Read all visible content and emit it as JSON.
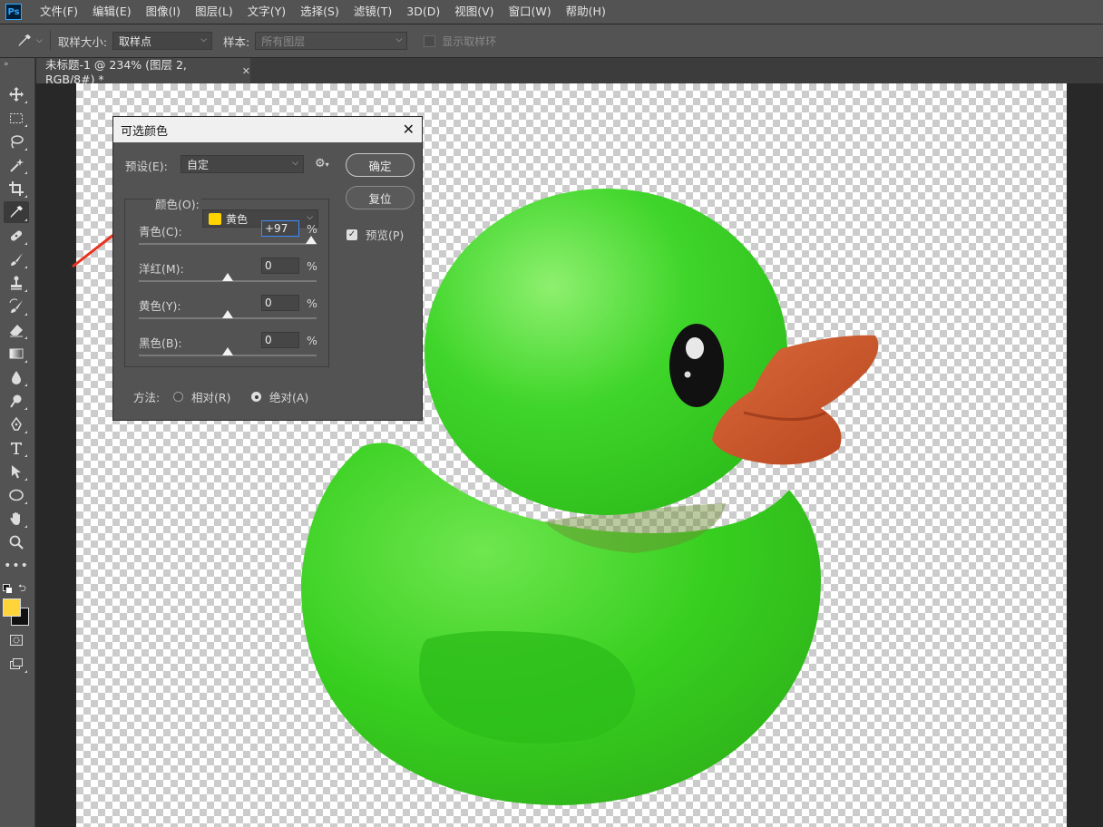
{
  "menubar": {
    "logo": "Ps",
    "items": [
      "文件(F)",
      "编辑(E)",
      "图像(I)",
      "图层(L)",
      "文字(Y)",
      "选择(S)",
      "滤镜(T)",
      "3D(D)",
      "视图(V)",
      "窗口(W)",
      "帮助(H)"
    ]
  },
  "options": {
    "sample_size_label": "取样大小:",
    "sample_size_value": "取样点",
    "sample_label": "样本:",
    "sample_value": "所有图层",
    "show_ring_label": "显示取样环"
  },
  "document": {
    "tab_title": "未标题-1 @ 234% (图层 2, RGB/8#) *"
  },
  "dialog": {
    "title": "可选颜色",
    "preset_label": "预设(E):",
    "preset_value": "自定",
    "ok_label": "确定",
    "reset_label": "复位",
    "preview_label": "预览(P)",
    "colors_label": "颜色(O):",
    "colors_value": "黄色",
    "colors_swatch": "#ffd400",
    "sliders": [
      {
        "label": "青色(C):",
        "value": "+97",
        "unit": "%",
        "position": 0.97
      },
      {
        "label": "洋红(M):",
        "value": "0",
        "unit": "%",
        "position": 0.5
      },
      {
        "label": "黄色(Y):",
        "value": "0",
        "unit": "%",
        "position": 0.5
      },
      {
        "label": "黑色(B):",
        "value": "0",
        "unit": "%",
        "position": 0.5
      }
    ],
    "method_label": "方法:",
    "method_relative": "相对(R)",
    "method_absolute": "绝对(A)"
  },
  "colors": {
    "foreground": "#ffd43b",
    "background": "#111111",
    "duck_body": "#33cc1a",
    "duck_beak": "#c8552a",
    "annotation_arrow": "#e8331e"
  }
}
